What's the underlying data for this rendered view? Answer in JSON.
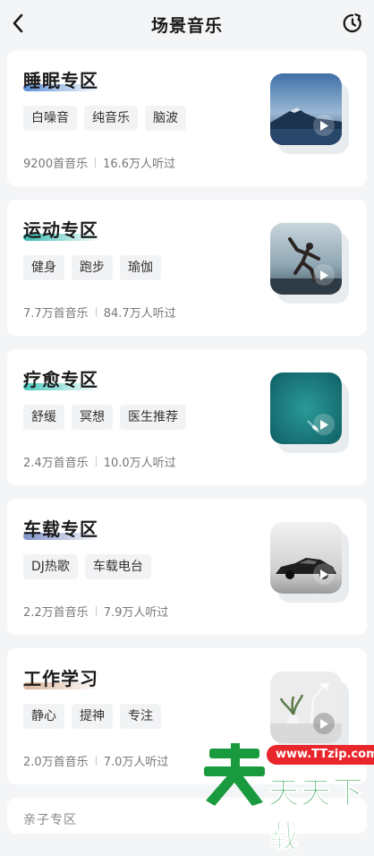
{
  "header": {
    "title": "场景音乐",
    "back_icon": "chevron-left-icon",
    "history_icon": "history-icon"
  },
  "cards": [
    {
      "name": "睡眠专区",
      "accent": "#5b8fd6",
      "tags": [
        "白噪音",
        "纯音乐",
        "脑波"
      ],
      "songs": "9200首音乐",
      "listeners": "16.6万人听过",
      "cover": "mountain-night-sky-image"
    },
    {
      "name": "运动专区",
      "accent": "#36b9b0",
      "tags": [
        "健身",
        "跑步",
        "瑜伽"
      ],
      "songs": "7.7万首音乐",
      "listeners": "84.7万人听过",
      "cover": "runner-silhouette-image"
    },
    {
      "name": "疗愈专区",
      "accent": "#49c8be",
      "tags": [
        "舒缓",
        "冥想",
        "医生推荐"
      ],
      "songs": "2.4万首音乐",
      "listeners": "10.0万人听过",
      "cover": "sea-boat-aerial-image"
    },
    {
      "name": "车载专区",
      "accent": "#7d91c9",
      "tags": [
        "DJ热歌",
        "车载电台"
      ],
      "songs": "2.2万首音乐",
      "listeners": "7.9万人听过",
      "cover": "sports-car-image"
    },
    {
      "name": "工作学习",
      "accent": "#d9b49a",
      "tags": [
        "静心",
        "提神",
        "专注"
      ],
      "songs": "2.0万首音乐",
      "listeners": "7.0万人听过",
      "cover": "desk-lamp-plant-image"
    }
  ],
  "partial_card": {
    "name": "亲子专区"
  },
  "watermark": {
    "logo_char": "天",
    "url": "www.TTzip.com",
    "text": "天天下载"
  }
}
